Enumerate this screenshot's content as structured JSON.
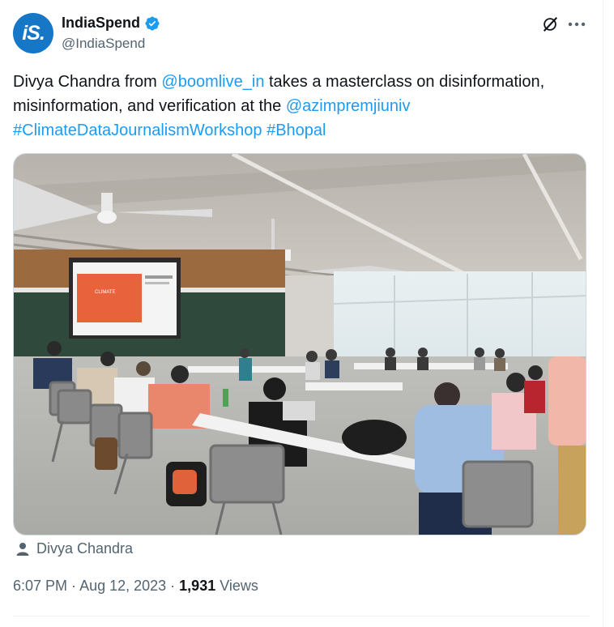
{
  "account": {
    "avatar_text": "iS.",
    "display_name": "IndiaSpend",
    "handle": "@IndiaSpend",
    "verified_icon": "verified-badge-icon",
    "brand_color": "#1677c6"
  },
  "actions": {
    "grok_icon": "grok-icon",
    "more_icon": "more-options-icon"
  },
  "tweet": {
    "text_1": "Divya Chandra from ",
    "mention_1": "@boomlive_in",
    "text_2": " takes a masterclass on disinformation, misinformation, and verification at the ",
    "mention_2": "@azimpremjiuniv",
    "hashtag_1": "#ClimateDataJournalismWorkshop",
    "hashtag_2": "#Bhopal",
    "link_color": "#1d9bf0"
  },
  "media": {
    "slide_heading": "CLIMATE",
    "tagged_user_icon": "person-icon",
    "tagged_user": "Divya Chandra"
  },
  "meta": {
    "time": "6:07 PM",
    "separator_1": " · ",
    "date": "Aug 12, 2023",
    "separator_2": " · ",
    "views_count": "1,931",
    "views_label": " Views"
  }
}
